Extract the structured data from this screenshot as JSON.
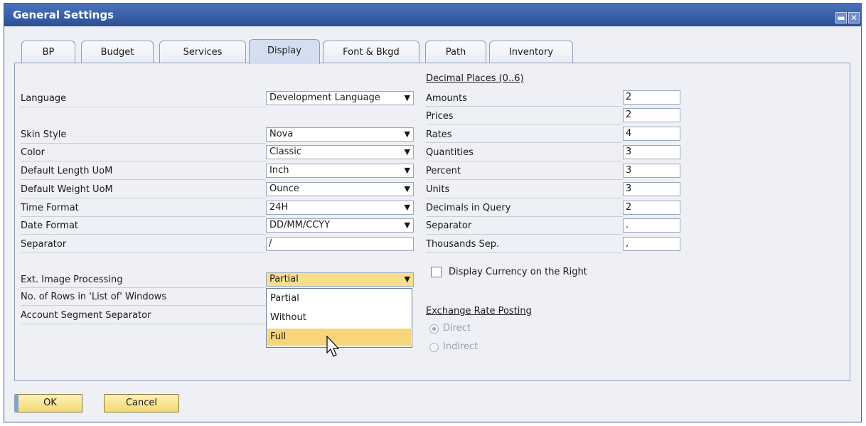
{
  "window": {
    "title": "General Settings"
  },
  "tabs": [
    "BP",
    "Budget",
    "Services",
    "Display",
    "Font & Bkgd",
    "Path",
    "Inventory"
  ],
  "active_tab": "Display",
  "left": {
    "language": {
      "label": "Language",
      "value": "Development Language"
    },
    "skin_style": {
      "label": "Skin Style",
      "value": "Nova"
    },
    "color": {
      "label": "Color",
      "value": "Classic"
    },
    "length_uom": {
      "label": "Default Length UoM",
      "value": "Inch"
    },
    "weight_uom": {
      "label": "Default Weight UoM",
      "value": "Ounce"
    },
    "time_format": {
      "label": "Time Format",
      "value": "24H"
    },
    "date_format": {
      "label": "Date Format",
      "value": "DD/MM/CCYY"
    },
    "separator": {
      "label": "Separator",
      "value": "/"
    },
    "ext_image": {
      "label": "Ext. Image Processing",
      "value": "Partial"
    },
    "rows_list": {
      "label": "No. of Rows in 'List of' Windows"
    },
    "acct_sep": {
      "label": "Account Segment Separator"
    },
    "dropdown_options": [
      "Partial",
      "Without",
      "Full"
    ]
  },
  "right": {
    "decimal_header": "Decimal Places  (0..6)",
    "amounts": {
      "label": "Amounts",
      "value": "2"
    },
    "prices": {
      "label": "Prices",
      "value": "2"
    },
    "rates": {
      "label": "Rates",
      "value": "4"
    },
    "quantities": {
      "label": "Quantities",
      "value": "3"
    },
    "percent": {
      "label": "Percent",
      "value": "3"
    },
    "units": {
      "label": "Units",
      "value": "3"
    },
    "decimals_query": {
      "label": "Decimals in Query",
      "value": "2"
    },
    "separator": {
      "label": "Separator",
      "value": "."
    },
    "thousands": {
      "label": "Thousands Sep.",
      "value": ","
    },
    "display_currency": "Display Currency on the Right",
    "exchange_header": "Exchange Rate Posting",
    "direct": "Direct",
    "indirect": "Indirect"
  },
  "buttons": {
    "ok": "OK",
    "cancel": "Cancel"
  }
}
